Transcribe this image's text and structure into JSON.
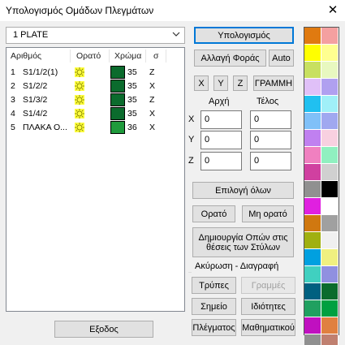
{
  "window": {
    "title": "Υπολογισμός Ομάδων Πλεγμάτων",
    "close_glyph": "✕"
  },
  "plate_select": {
    "value": "1 PLATE"
  },
  "list": {
    "columns": [
      "Αριθμός",
      "Ορατό",
      "Χρώμα",
      "σ"
    ],
    "rows": [
      {
        "num": "1",
        "name": "S1/1/2(1)",
        "color": "#0b6b2d",
        "value": "35",
        "axis": "Z"
      },
      {
        "num": "2",
        "name": "S1/2/2",
        "color": "#0b6b2d",
        "value": "35",
        "axis": "X"
      },
      {
        "num": "3",
        "name": "S1/3/2",
        "color": "#0b6b2d",
        "value": "35",
        "axis": "Z"
      },
      {
        "num": "4",
        "name": "S1/4/2",
        "color": "#0b6b2d",
        "value": "35",
        "axis": "X"
      },
      {
        "num": "5",
        "name": "ΠΛΑΚΑ Ο...",
        "color": "#1f9a3c",
        "value": "36",
        "axis": "X"
      }
    ]
  },
  "buttons": {
    "compute": "Υπολογισμός",
    "change_direction": "Αλλαγή Φοράς",
    "auto": "Auto",
    "x": "X",
    "y": "Y",
    "z": "Z",
    "line": "ΓΡΑΜΜΗ",
    "select_all": "Επιλογή όλων",
    "visible": "Ορατό",
    "not_visible": "Μη ορατό",
    "create_holes": "Δημιουργία Οπών στις θέσεις των Στύλων",
    "holes": "Τρύπες",
    "lines": "Γραμμές",
    "point": "Σημείο",
    "properties": "Ιδιότητες",
    "meshes": "Πλέγματος",
    "math": "Μαθηματικού",
    "exit": "Εξοδος"
  },
  "coords": {
    "start_label": "Αρχή",
    "end_label": "Τέλος",
    "axes": [
      "X",
      "Y",
      "Z"
    ],
    "start": [
      "0",
      "0",
      "0"
    ],
    "end": [
      "0",
      "0",
      "0"
    ]
  },
  "cancel_delete_group": "Ακύρωση - Διαγραφή",
  "palette": [
    "#e07a10",
    "#f4a0a0",
    "#ffff00",
    "#ffff90",
    "#c8e060",
    "#e8f8c0",
    "#e0c0f8",
    "#b0a0f0",
    "#20c0f0",
    "#a0f0f8",
    "#80c0f8",
    "#a0a8f0",
    "#c080f0",
    "#f8d0e0",
    "#f080c0",
    "#90f0c0",
    "#d040a0",
    "#d0d0d0",
    "#909090",
    "#000000",
    "#e020e0",
    "#ffffff",
    "#d07810",
    "#a0a0a0",
    "#a0b010",
    "#f0f0f0",
    "#00a0e0",
    "#f0f080",
    "#40d0c0",
    "#9090e0",
    "#006080",
    "#0b6b2d",
    "#20a060",
    "#00a040",
    "#c010c0",
    "#e08040",
    "#909090",
    "#c08070"
  ]
}
